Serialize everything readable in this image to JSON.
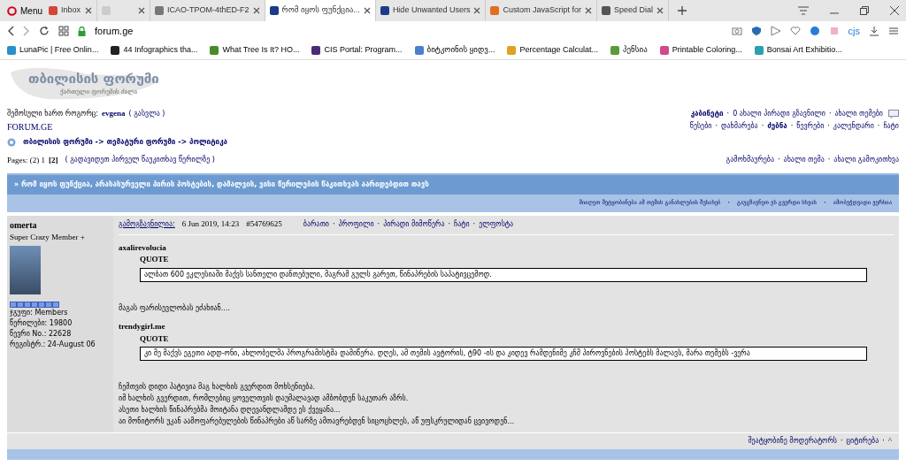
{
  "browser": {
    "menu_label": "Menu",
    "tabs": [
      {
        "title": "Inbox",
        "kind": "mail",
        "selected": false
      },
      {
        "kind": "blank",
        "selected": false
      },
      {
        "title": "ICAO-TPOM-4thED-F2",
        "kind": "doc",
        "selected": false
      },
      {
        "title": "რომ იყოს ფუნქცია...",
        "kind": "forum",
        "selected": true
      },
      {
        "title": "Hide Unwanted Users",
        "kind": "forum",
        "selected": false
      },
      {
        "title": "Custom JavaScript for",
        "kind": "ext",
        "selected": false
      },
      {
        "title": "Speed Dial",
        "kind": "grid",
        "selected": false
      }
    ],
    "address": "forum.ge",
    "profile_label": "cjs",
    "bookmarks": [
      {
        "label": "LunaPic | Free Onlin...",
        "color": "#2a8fc7"
      },
      {
        "label": "44 Infographics tha...",
        "color": "#222222"
      },
      {
        "label": "What Tree Is It? HO...",
        "color": "#4a8a2a"
      },
      {
        "label": "CIS Portal: Program...",
        "color": "#4b2a7a"
      },
      {
        "label": "ბიტკოინის ყიდვ...",
        "color": "#4a7fd0"
      },
      {
        "label": "Percentage Calculat...",
        "color": "#e0a020"
      },
      {
        "label": "პენსია",
        "color": "#5a9a3a"
      },
      {
        "label": "Printable Coloring...",
        "color": "#d04a8a"
      },
      {
        "label": "Bonsai Art Exhibitio...",
        "color": "#2aa0b0"
      }
    ]
  },
  "site": {
    "logo_title": "თბილისის ფორუმი",
    "logo_subtitle": "ქართული ფორუმის ძალა",
    "user_line": {
      "label": "შემოსული ხართ როგორც:",
      "username": "evgena",
      "logout": "( გასვლა )"
    },
    "site_name": "FORUM.GE",
    "separator": "·",
    "top_links": [
      {
        "label": "კაბინეტი",
        "bold": true
      },
      {
        "label": "0 ახალი პირადი გზავნილი",
        "bold": false
      },
      {
        "label": "ახალი თემები",
        "bold": false
      }
    ],
    "nav_links": [
      {
        "label": "წესები",
        "bold": false
      },
      {
        "label": "დახმარება",
        "bold": false
      },
      {
        "label": "ძებნა",
        "bold": true
      },
      {
        "label": "წევრები",
        "bold": false
      },
      {
        "label": "კალენდარი",
        "bold": false
      },
      {
        "label": "ჩატი",
        "bold": false
      }
    ],
    "breadcrumb": "თბილისის ფორუმი -> თემატური ფორუმი -> პოლიტიკა",
    "pages": {
      "label": "Pages: (2) 1",
      "current": "[2]",
      "first_unread": "( გადავიდეთ პირველ წაუკითხავ წერილზე )"
    },
    "topic_actions": [
      "გამოხმაურება",
      "ახალი თემა",
      "ახალი გამოკითხვა"
    ],
    "topic_title": "» რომ იყოს ფუნქცია, არასასურველი პირის პოსტების, დამალვის, ვისი წერილების წაკითხვას აარიდებდით თავს",
    "topic_tools": [
      "მიიღეთ შეტყობინება ამ თემის განახლების შესახებ",
      "გაუგზავნეთ ეს გვერდი სხვას",
      "ამობეჭდვადი ვერსია"
    ]
  },
  "post": {
    "author": "omerta",
    "rank": "Super Crazy Member +",
    "details": [
      "ჯგუფი: Members",
      "წერილები: 19800",
      "წევრი No.: 22628",
      "რეგისტრ.: 24-August 06"
    ],
    "posted_label": "გამოგზავნილია:",
    "posted_date": "6 Jun 2019, 14:23",
    "post_number": "#54769625",
    "author_links": [
      "ბარათი",
      "პროფილი",
      "პირადი მიმოწერა",
      "ჩატი",
      "ელფოსტა"
    ],
    "body": [
      {
        "kind": "quote",
        "author": "axalirevolucia",
        "label": "QUOTE",
        "text": "ალბათ 600 ეკლესიაში მაქვს სანთელი დანთებული, მაგრამ გულს გარეთ, წინაპრების საპატივცემოდ."
      },
      {
        "kind": "text",
        "lines": [
          "მაგას ფარისევლობას ეძახიან...."
        ]
      },
      {
        "kind": "quote",
        "author": "trendygirl.me",
        "label": "QUOTE",
        "text": "კი მე მაქვს ეგეთი ადდ-ონი, ახლობელმა პროგრამისტმა დამიწერა. დღეს, ამ თემის ავტორის, ტ90 -ის და კიდევ რამდენიმე კჩმ პიროვნების პოსტებს მალავს, მარა თემებს -ვერა"
      },
      {
        "kind": "text",
        "lines": [
          "ჩემთვის დიდი პატივია მაგ ხალხის გვერდით მოხსენიება.",
          "იმ ხალხის გვერდით, რომლებიც ყოველთვის დაუმალავად ამბობდენ საკუთარ აზრს.",
          "ასეთი ხალხის წინაპრებმა მოიტანა დღევანდლამდე ეს ქვეყანა...",
          "აი მონიტორს უკან აამოფარებულების წინაპრები აწ სარზე ამთავრებდენ სიცოცხლეს, აწ უფსკრულიდან ცვივოდენ..."
        ]
      }
    ],
    "footer_links": [
      "შეატყობინე მოდერატორს",
      "ციტირება"
    ],
    "top_link": "^"
  }
}
